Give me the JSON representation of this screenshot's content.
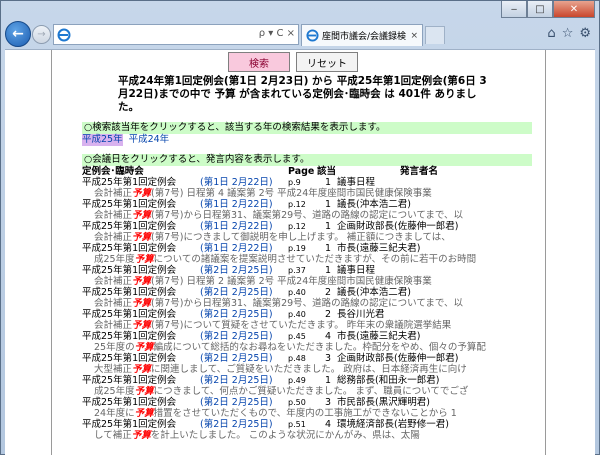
{
  "browser": {
    "tab_title": "座間市議会/会議録検索シ...",
    "tab_close": "×",
    "address_tools": "ρ ▾ C ×",
    "win_minimize": "‒",
    "win_maximize": "□",
    "win_close": "✕"
  },
  "form": {
    "search_label": "検索",
    "reset_label": "リセット"
  },
  "summary": "平成24年第1回定例会(第1日 2月23日) から 平成25年第1回定例会(第6日 3月22日)までの中で 予算 が含まれている定例会･臨時会 は 401件 ありました。",
  "year_hint": "○検索該当年をクリックすると、該当する年の検索結果を表示します。",
  "years": [
    "平成25年",
    "平成24年"
  ],
  "meeting_hint": "○会議日をクリックすると、発言内容を表示します。",
  "headers": {
    "meeting": "定例会･臨時会",
    "page": "Page",
    "match": "該当",
    "speaker": "発言者名"
  },
  "keyword": "予算",
  "results": [
    {
      "meeting": "平成25年第1回定例会",
      "date": "(第1日 2月22日)",
      "page": "p.9",
      "count": "1",
      "speaker": "議事日程",
      "pre": "会計補正",
      "post": "(第7号) 日程第 4 議案第 2号 平成24年度座間市国民健康保険事業"
    },
    {
      "meeting": "平成25年第1回定例会",
      "date": "(第1日 2月22日)",
      "page": "p.12",
      "count": "1",
      "speaker": "議長(沖本浩二君)",
      "pre": "会計補正",
      "post": "(第7号)から日程第31、議案第29号、道路の路線の認定についてまで、以"
    },
    {
      "meeting": "平成25年第1回定例会",
      "date": "(第1日 2月22日)",
      "page": "p.12",
      "count": "1",
      "speaker": "企画財政部長(佐藤伸一郎君)",
      "pre": "会計補正",
      "post": "(第7号)につきまして御説明を申し上げます。 補正額につきましては、"
    },
    {
      "meeting": "平成25年第1回定例会",
      "date": "(第1日 2月22日)",
      "page": "p.19",
      "count": "1",
      "speaker": "市長(遠藤三紀夫君)",
      "pre": "成25年度",
      "post": "についての諸議案を提案説明させていただきますが、その前に若干のお時間"
    },
    {
      "meeting": "平成25年第1回定例会",
      "date": "(第2日 2月25日)",
      "page": "p.37",
      "count": "1",
      "speaker": "議事日程",
      "pre": "会計補正",
      "post": "(第7号) 日程第 2 議案第 2号 平成24年度座間市国民健康保険事業"
    },
    {
      "meeting": "平成25年第1回定例会",
      "date": "(第2日 2月25日)",
      "page": "p.40",
      "count": "2",
      "speaker": "議長(沖本浩二君)",
      "pre": "会計補正",
      "post": "(第7号)から日程第31、議案第29号、道路の路線の認定についてまで、以"
    },
    {
      "meeting": "平成25年第1回定例会",
      "date": "(第2日 2月25日)",
      "page": "p.40",
      "count": "2",
      "speaker": "長谷川光君",
      "pre": "会計補正",
      "post": "(第7号)について質疑をさせていただきます。 昨年末の衆議院選挙結果"
    },
    {
      "meeting": "平成25年第1回定例会",
      "date": "(第2日 2月25日)",
      "page": "p.45",
      "count": "4",
      "speaker": "市長(遠藤三紀夫君)",
      "pre": "25年度の",
      "post": "編成について総括的なお尋ねをいただきました。枠配分をやめ、個々の予算配"
    },
    {
      "meeting": "平成25年第1回定例会",
      "date": "(第2日 2月25日)",
      "page": "p.48",
      "count": "3",
      "speaker": "企画財政部長(佐藤伸一郎君)",
      "pre": "大型補正",
      "post": "に関連しまして、ご質疑をいただきました。 政府は、日本経済再生に向け"
    },
    {
      "meeting": "平成25年第1回定例会",
      "date": "(第2日 2月25日)",
      "page": "p.49",
      "count": "1",
      "speaker": "総務部長(和田永一郎君)",
      "pre": "成25年度",
      "post": "につきまして、何点かご質疑いただきました。 まず、職員についてでござ"
    },
    {
      "meeting": "平成25年第1回定例会",
      "date": "(第2日 2月25日)",
      "page": "p.50",
      "count": "3",
      "speaker": "市民部長(黒沢輝明君)",
      "pre": "24年度に",
      "post": "措置をさせていただくもので、年度内の工事施工ができないことから 1"
    },
    {
      "meeting": "平成25年第1回定例会",
      "date": "(第2日 2月25日)",
      "page": "p.51",
      "count": "4",
      "speaker": "環境経済部長(岩野修一君)",
      "pre": "して補正",
      "post": "を計上いたしました。 このような状況にかんがみ、県は、太陽"
    }
  ]
}
